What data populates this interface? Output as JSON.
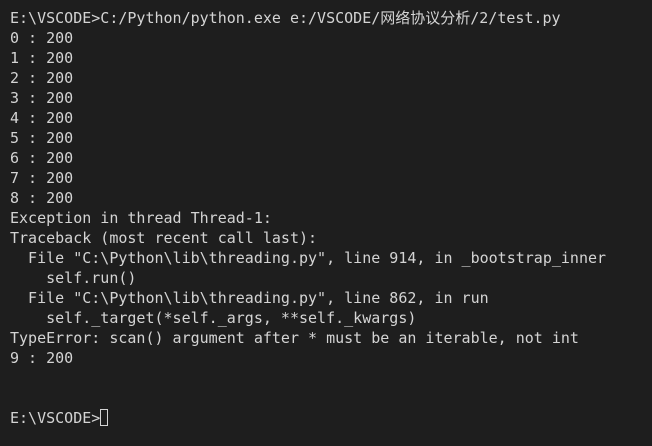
{
  "terminal": {
    "lines": [
      "E:\\VSCODE>C:/Python/python.exe e:/VSCODE/网络协议分析/2/test.py",
      "0 : 200",
      "1 : 200",
      "2 : 200",
      "3 : 200",
      "4 : 200",
      "5 : 200",
      "6 : 200",
      "7 : 200",
      "8 : 200",
      "Exception in thread Thread-1:",
      "Traceback (most recent call last):",
      "  File \"C:\\Python\\lib\\threading.py\", line 914, in _bootstrap_inner",
      "    self.run()",
      "  File \"C:\\Python\\lib\\threading.py\", line 862, in run",
      "    self._target(*self._args, **self._kwargs)",
      "TypeError: scan() argument after * must be an iterable, not int",
      "9 : 200",
      "",
      "",
      ""
    ],
    "prompt": "E:\\VSCODE>",
    "input": ""
  },
  "colors": {
    "background": "#1e1e1e",
    "foreground": "#d4d4d4"
  }
}
